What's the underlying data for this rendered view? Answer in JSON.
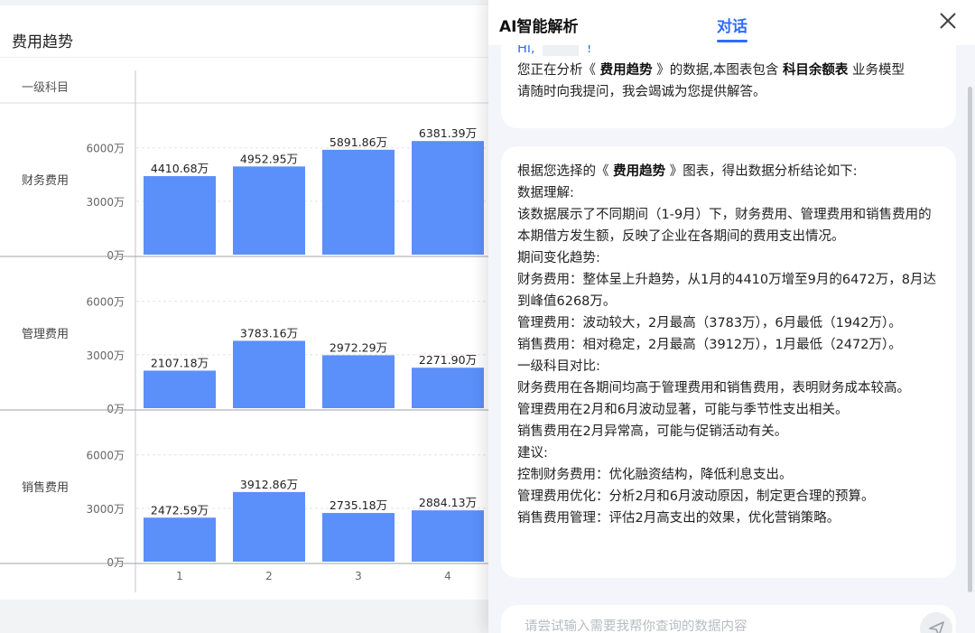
{
  "chart_card": {
    "title": "费用趋势",
    "category_header": "一级科目"
  },
  "chart_data": {
    "type": "bar",
    "x": [
      "1",
      "2",
      "3",
      "4"
    ],
    "ylim": [
      0,
      7000
    ],
    "y_ticks": [
      "6000万",
      "3000万",
      "0万"
    ],
    "y_tick_values": [
      6000,
      3000,
      0
    ],
    "series": [
      {
        "name": "财务费用",
        "values": [
          4410.68,
          4952.95,
          5891.86,
          6381.39
        ],
        "labels": [
          "4410.68万",
          "4952.95万",
          "5891.86万",
          "6381.39万"
        ]
      },
      {
        "name": "管理费用",
        "values": [
          2107.18,
          3783.16,
          2972.29,
          2271.9
        ],
        "labels": [
          "2107.18万",
          "3783.16万",
          "2972.29万",
          "2271.90万"
        ]
      },
      {
        "name": "销售费用",
        "values": [
          2472.59,
          3912.86,
          2735.18,
          2884.13
        ],
        "labels": [
          "2472.59万",
          "3912.86万",
          "2735.18万",
          "2884.13万"
        ]
      }
    ],
    "bar_color": "#5b8ff9"
  },
  "ai_panel": {
    "title": "AI智能解析",
    "tab_label": "对话",
    "close_icon": "close-icon",
    "greeting": {
      "hi": "Hi,",
      "excl": "!",
      "l2a": "您正在分析《 ",
      "chart_name": "费用趋势",
      "l2b": " 》的数据,本图表包含 ",
      "model_name": "科目余额表",
      "l2c": " 业务模型",
      "l3": "请随时向我提问，我会竭诚为您提供解答。"
    },
    "analysis": {
      "intro_a": "根据您选择的《 ",
      "intro_chart": "费用趋势",
      "intro_b": " 》图表，得出数据分析结论如下:",
      "lines": [
        "数据理解:",
        "该数据展示了不同期间（1-9月）下，财务费用、管理费用和销售费用的本期借方发生额，反映了企业在各期间的费用支出情况。",
        "期间变化趋势:",
        "财务费用：整体呈上升趋势，从1月的4410万增至9月的6472万，8月达到峰值6268万。",
        "管理费用：波动较大，2月最高（3783万），6月最低（1942万）。",
        "销售费用：相对稳定，2月最高（3912万），1月最低（2472万）。",
        "一级科目对比:",
        "财务费用在各期间均高于管理费用和销售费用，表明财务成本较高。",
        "管理费用在2月和6月波动显著，可能与季节性支出相关。",
        "销售费用在2月异常高，可能与促销活动有关。",
        "建议:",
        "控制财务费用：优化融资结构，降低利息支出。",
        "管理费用优化：分析2月和6月波动原因，制定更合理的预算。",
        "销售费用管理：评估2月高支出的效果，优化营销策略。"
      ]
    },
    "input": {
      "placeholder": "请尝试输入需要我帮你查询的数据内容",
      "send_icon": "send-icon"
    },
    "accent_color": "#2f6bff"
  }
}
